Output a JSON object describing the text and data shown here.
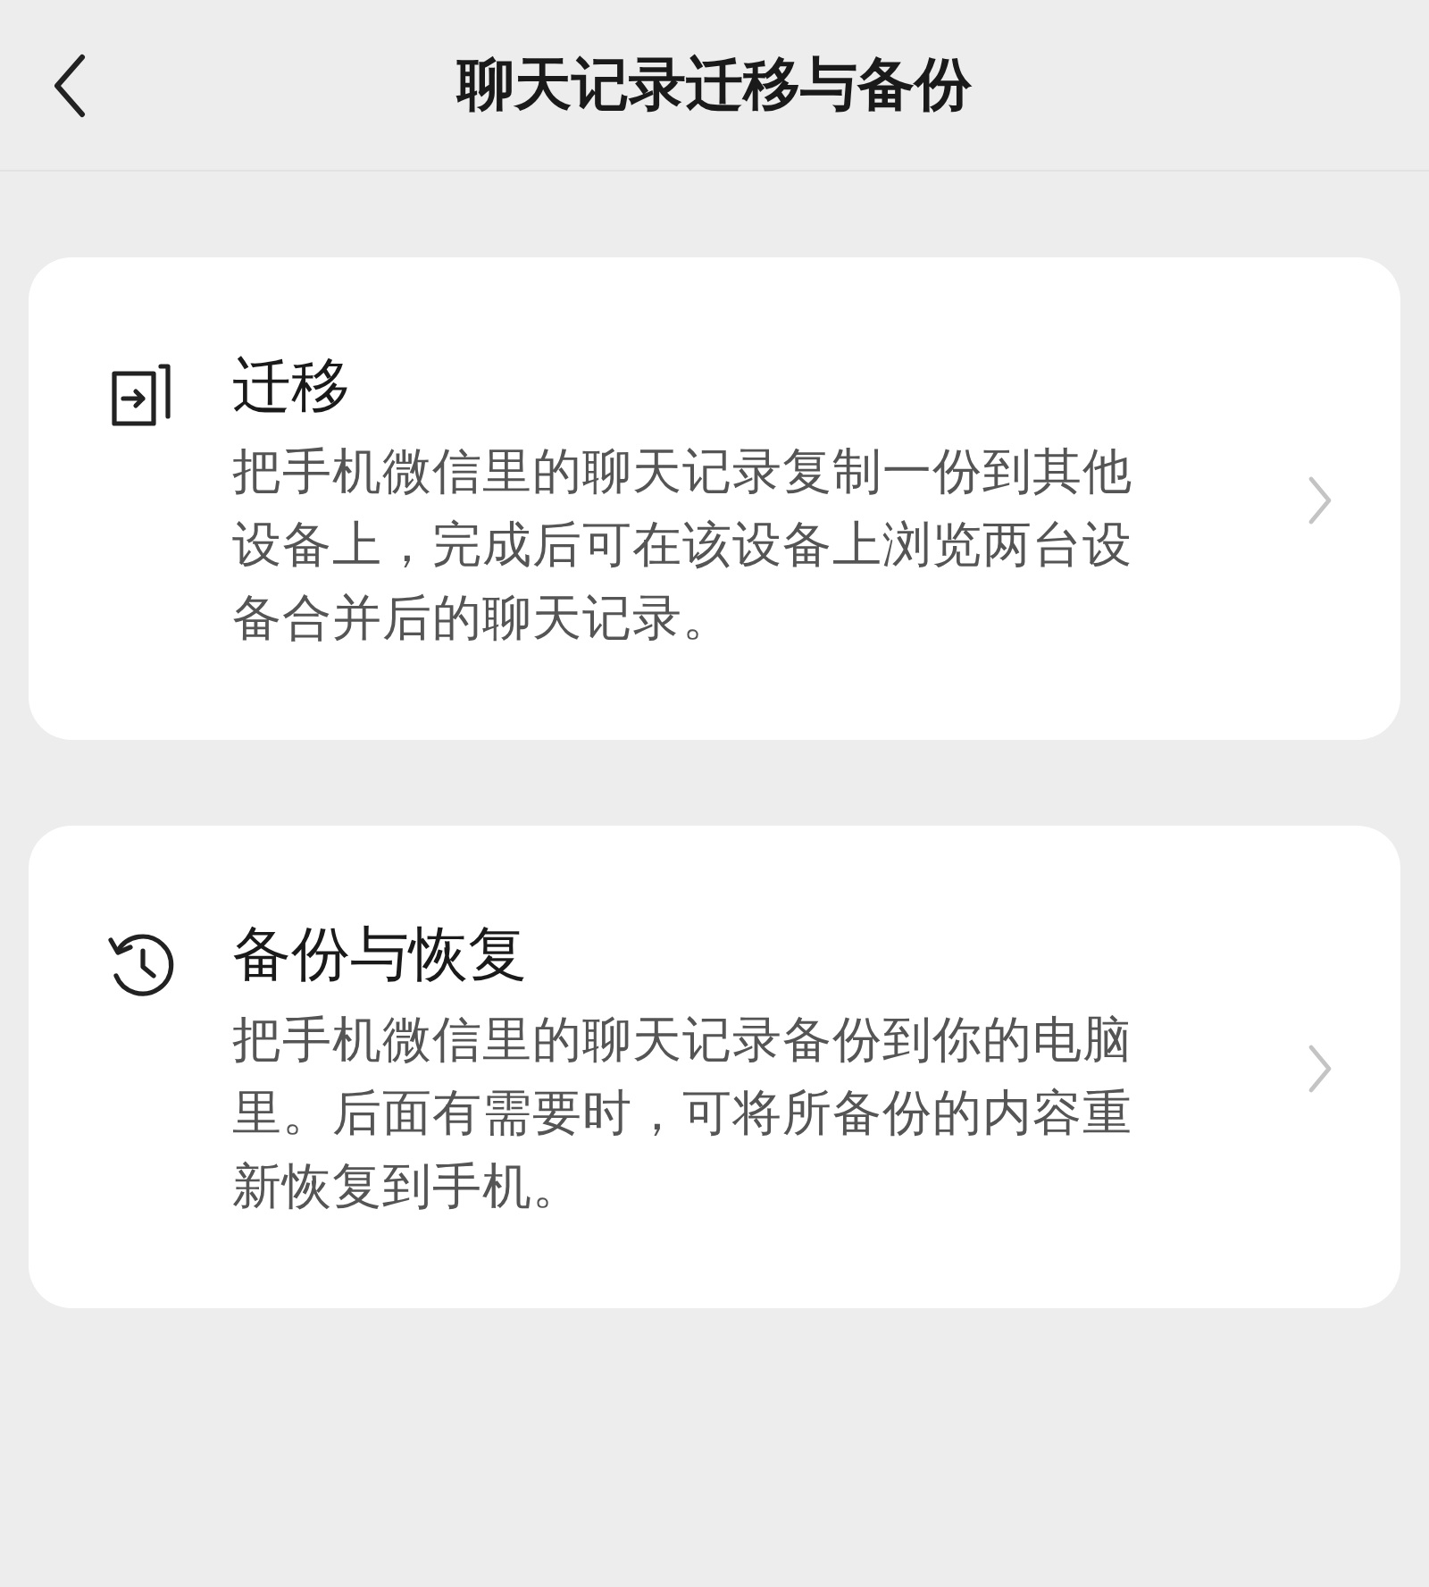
{
  "header": {
    "title": "聊天记录迁移与备份"
  },
  "options": [
    {
      "kind": "migrate",
      "title": "迁移",
      "description": "把手机微信里的聊天记录复制一份到其他设备上，完成后可在该设备上浏览两台设备合并后的聊天记录。"
    },
    {
      "kind": "backup",
      "title": "备份与恢复",
      "description": "把手机微信里的聊天记录备份到你的电脑里。后面有需要时，可将所备份的内容重新恢复到手机。"
    }
  ]
}
